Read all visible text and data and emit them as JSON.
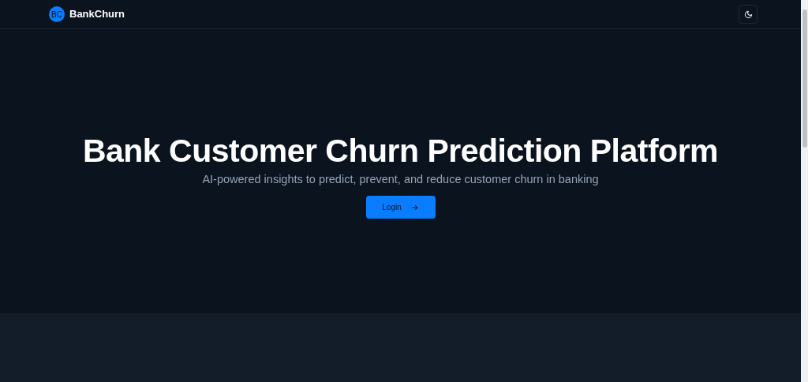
{
  "header": {
    "logo_initials": "BC",
    "brand": "BankChurn"
  },
  "hero": {
    "title": "Bank Customer Churn Prediction Platform",
    "subtitle": "AI-powered insights to predict, prevent, and reduce customer churn in banking",
    "button": "Login"
  }
}
